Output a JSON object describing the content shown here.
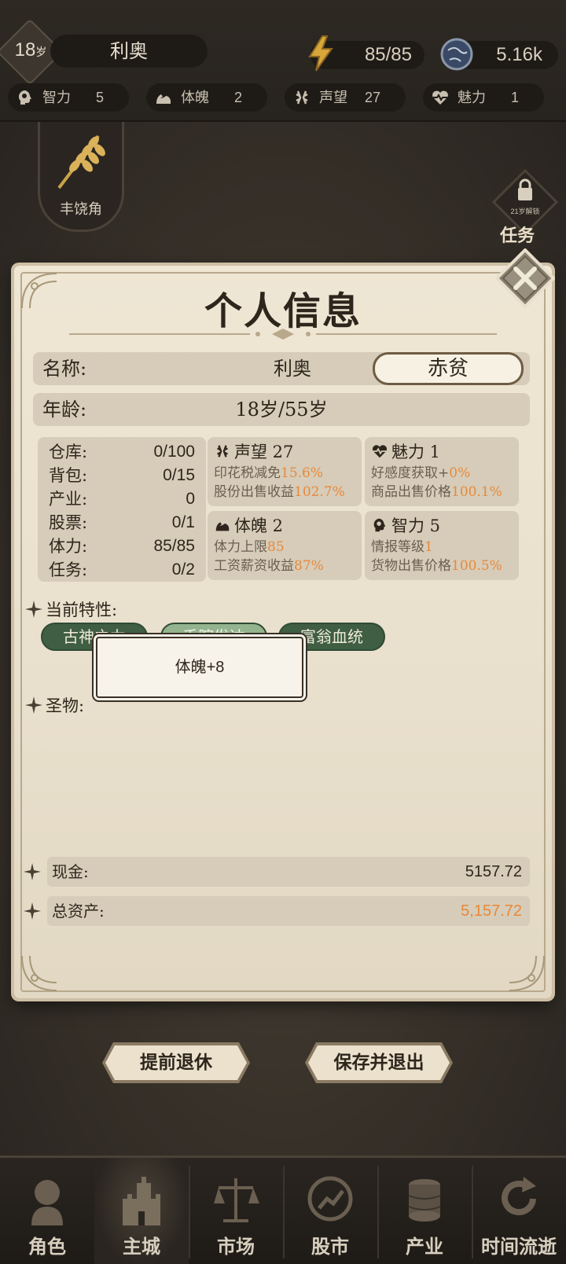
{
  "player": {
    "age": "18",
    "age_unit": "岁",
    "name": "利奥",
    "energy": "85/85",
    "money_short": "5.16k"
  },
  "stats": [
    {
      "label": "智力",
      "value": "5",
      "icon": "brain-icon"
    },
    {
      "label": "体魄",
      "value": "2",
      "icon": "muscle-icon"
    },
    {
      "label": "声望",
      "value": "27",
      "icon": "laurel-icon"
    },
    {
      "label": "魅力",
      "value": "1",
      "icon": "heartbeat-icon"
    }
  ],
  "side": {
    "cornucopia_label": "丰饶角",
    "task_lock_text": "21岁解锁",
    "task_label": "任务"
  },
  "dialog": {
    "title": "个人信息",
    "name_key": "名称:",
    "name_value": "利奥",
    "status_badge": "赤贫",
    "age_key": "年龄:",
    "age_value": "18岁/55岁",
    "storage": [
      {
        "k": "仓库:",
        "v": "0/100"
      },
      {
        "k": "背包:",
        "v": "0/15"
      },
      {
        "k": "产业:",
        "v": "0"
      },
      {
        "k": "股票:",
        "v": "0/1"
      },
      {
        "k": "体力:",
        "v": "85/85"
      },
      {
        "k": "任务:",
        "v": "0/2"
      }
    ],
    "reputation": {
      "title": "声望 27",
      "l1_text": "印花税减免",
      "l1_value": "15.6%",
      "l2_text": "股份出售收益",
      "l2_value": "102.7%"
    },
    "charm": {
      "title": "魅力 1",
      "l1_text": "好感度获取+",
      "l1_value": "0%",
      "l2_text": "商品出售价格",
      "l2_value": "100.1%"
    },
    "physique": {
      "title": "体魄 2",
      "l1_text": "体力上限",
      "l1_value": "85",
      "l2_text": "工资薪资收益",
      "l2_value": "87%"
    },
    "intelligence": {
      "title": "智力 5",
      "l1_text": "情报等级",
      "l1_value": "1",
      "l2_text": "货物出售价格",
      "l2_value": "100.5%"
    },
    "traits_label": "当前特性:",
    "traits": [
      "古神之力",
      "手腕发达",
      "富翁血统"
    ],
    "tooltip": "体魄+8",
    "relics_label": "圣物:",
    "cash_key": "现金:",
    "cash_value": "5157.72",
    "assets_key": "总资产:",
    "assets_value": "5,157.72"
  },
  "actions": {
    "retire": "提前退休",
    "save_exit": "保存并退出"
  },
  "nav": [
    "角色",
    "主城",
    "市场",
    "股市",
    "产业",
    "时间流逝"
  ],
  "colors": {
    "accent_orange": "#e8893a",
    "trait_green": "#3f5e44",
    "parchment": "#efe6d4"
  }
}
